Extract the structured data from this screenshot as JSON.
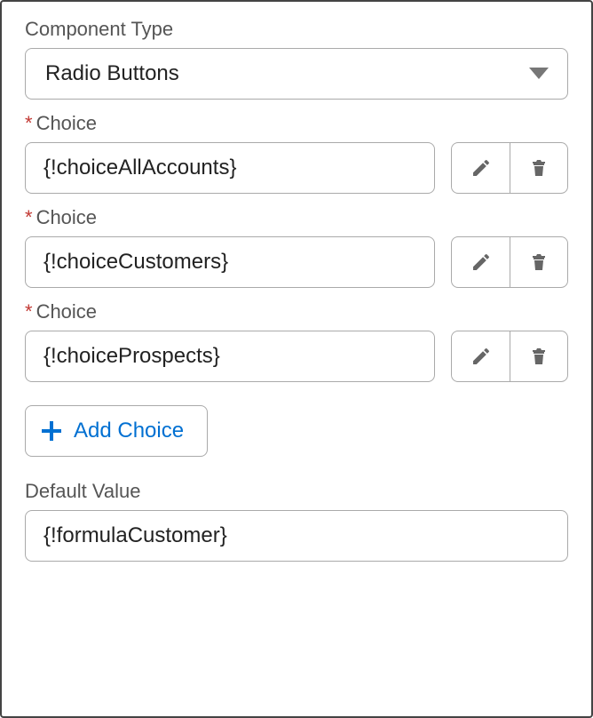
{
  "componentType": {
    "label": "Component Type",
    "value": "Radio Buttons"
  },
  "choiceLabel": "Choice",
  "choices": [
    {
      "value": "{!choiceAllAccounts}"
    },
    {
      "value": "{!choiceCustomers}"
    },
    {
      "value": "{!choiceProspects}"
    }
  ],
  "addChoice": {
    "label": "Add Choice"
  },
  "defaultValue": {
    "label": "Default Value",
    "value": "{!formulaCustomer}"
  },
  "colors": {
    "link": "#0070d2",
    "required": "#c23934",
    "iconGray": "#666"
  }
}
